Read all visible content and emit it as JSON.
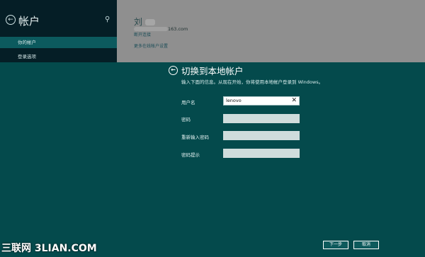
{
  "sidebar": {
    "title": "帐户",
    "back_icon": "back-arrow-icon",
    "search_icon": "search-icon",
    "items": [
      {
        "label": "你的帐户",
        "active": true
      },
      {
        "label": "登录选项",
        "active": false
      }
    ]
  },
  "account": {
    "name": "刘",
    "email_suffix": "163.com",
    "disconnect_link": "断开连接",
    "more_settings_link": "更多在线帐户设置"
  },
  "dialog": {
    "title": "切换到本地帐户",
    "description": "输入下面的信息。从现在开始，你将使用本地帐户登录到 Windows。",
    "fields": {
      "username_label": "用户名",
      "username_value": "lenovo",
      "password_label": "密码",
      "reenter_label": "重新输入密码",
      "hint_label": "密码提示"
    },
    "buttons": {
      "next": "下一步",
      "cancel": "取消"
    }
  },
  "watermark": "三联网 3LIAN.COM",
  "colors": {
    "dialog_bg": "#044a4c",
    "sidebar_bg": "#051e26",
    "overlay_gray": "#8f8f8f"
  }
}
